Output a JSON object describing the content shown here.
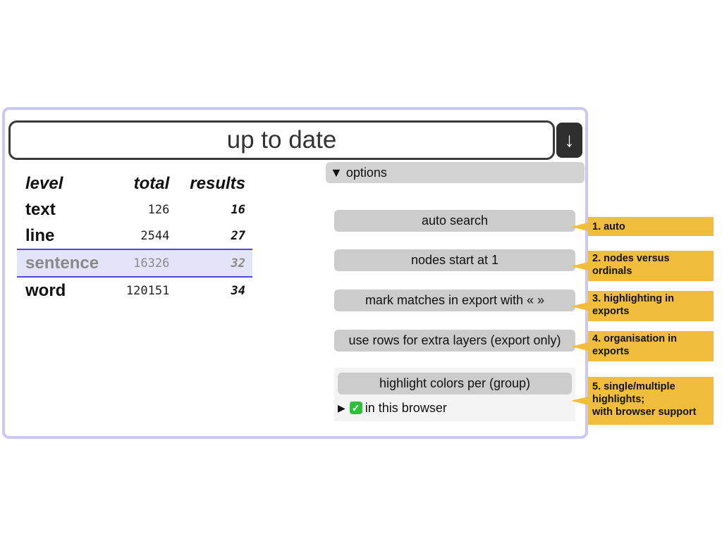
{
  "status": {
    "text": "up to date"
  },
  "download_button": {
    "glyph": "↓"
  },
  "stats": {
    "headers": {
      "level": "level",
      "total": "total",
      "results": "results"
    },
    "rows": [
      {
        "level": "text",
        "total": "126",
        "results": "16"
      },
      {
        "level": "line",
        "total": "2544",
        "results": "27"
      },
      {
        "level": "sentence",
        "total": "16326",
        "results": "32",
        "selected": true
      },
      {
        "level": "word",
        "total": "120151",
        "results": "34"
      }
    ]
  },
  "options": {
    "toggle": "▼ options",
    "buttons": {
      "auto_search": "auto search",
      "nodes_start": "nodes start at 1",
      "mark_matches": "mark matches in export with « »",
      "use_rows": "use rows for extra layers (export only)",
      "highlight_colors": "highlight colors per (group)"
    },
    "browser_support": {
      "arrow": "▶",
      "text": "in this browser"
    }
  },
  "callouts": {
    "c1": "1. auto",
    "c2": "2. nodes versus ordinals",
    "c3": "3. highlighting in exports",
    "c4": "4. organisation in exports",
    "c5a": "5. single/multiple highlights;",
    "c5b": "with browser support"
  },
  "colors": {
    "panel_border": "#c9c9f3",
    "selected_row_bg": "#e4e4f8",
    "selected_row_border": "#4a4adb",
    "callout": "#f0bd3c",
    "button_bg": "#cccccc"
  }
}
